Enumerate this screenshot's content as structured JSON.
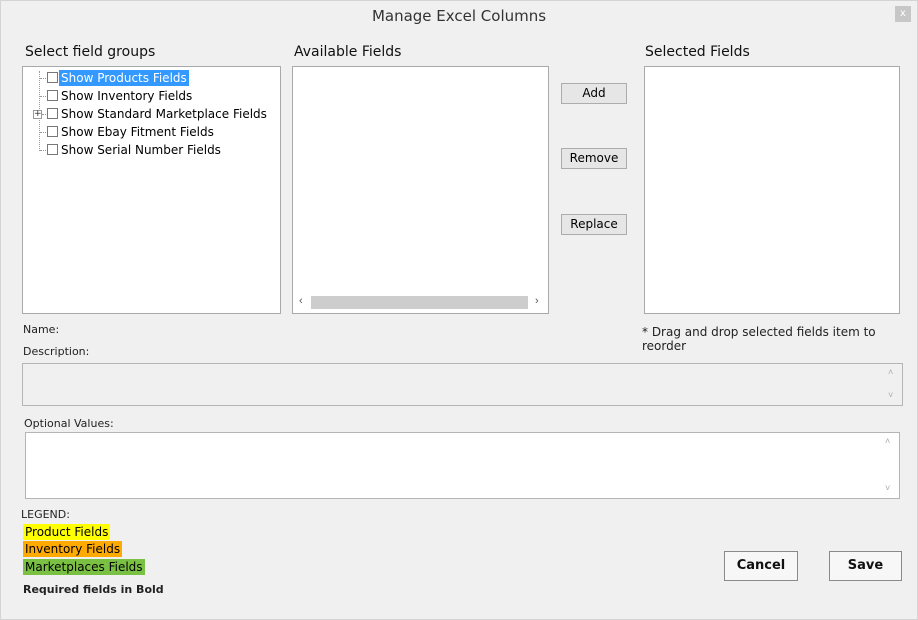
{
  "window": {
    "title": "Manage Excel Columns",
    "close_label": "x"
  },
  "field_groups": {
    "label": "Select field groups",
    "items": [
      {
        "label": "Show Products Fields",
        "checked": false,
        "selected": true,
        "expandable": false
      },
      {
        "label": "Show Inventory Fields",
        "checked": false,
        "selected": false,
        "expandable": false
      },
      {
        "label": "Show Standard Marketplace Fields",
        "checked": false,
        "selected": false,
        "expandable": true
      },
      {
        "label": "Show Ebay Fitment Fields",
        "checked": false,
        "selected": false,
        "expandable": false
      },
      {
        "label": "Show Serial Number Fields",
        "checked": false,
        "selected": false,
        "expandable": false
      }
    ]
  },
  "available_fields": {
    "label": "Available Fields",
    "scroll_left": "‹",
    "scroll_right": "›"
  },
  "actions": {
    "add_label": "Add",
    "remove_label": "Remove",
    "replace_label": "Replace"
  },
  "selected_fields": {
    "label": "Selected Fields",
    "hint": "* Drag and drop selected fields item to reorder"
  },
  "details": {
    "name_label": "Name:",
    "description_label": "Description:",
    "optional_values_label": "Optional Values:",
    "scroll_up": "˄",
    "scroll_down": "˅"
  },
  "legend": {
    "title": "LEGEND:",
    "items": [
      {
        "label": "Product Fields",
        "color": "#ffff00"
      },
      {
        "label": "Inventory Fields",
        "color": "#ffaa00"
      },
      {
        "label": "Marketplaces Fields",
        "color": "#7ac143"
      }
    ],
    "required_note": "Required fields in Bold"
  },
  "footer": {
    "cancel_label": "Cancel",
    "save_label": "Save"
  },
  "colors": {
    "selection": "#3399ff",
    "window_bg": "#f0f0f0"
  }
}
